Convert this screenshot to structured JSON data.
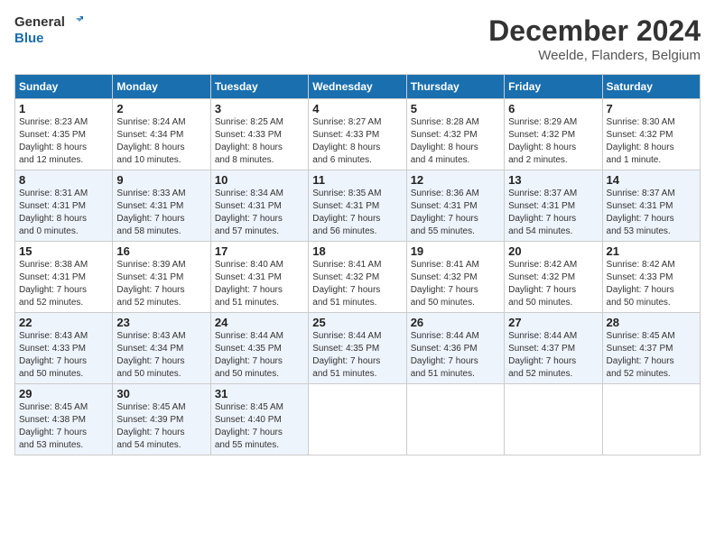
{
  "logo": {
    "general": "General",
    "blue": "Blue"
  },
  "title": {
    "month": "December 2024",
    "location": "Weelde, Flanders, Belgium"
  },
  "headers": [
    "Sunday",
    "Monday",
    "Tuesday",
    "Wednesday",
    "Thursday",
    "Friday",
    "Saturday"
  ],
  "weeks": [
    [
      {
        "day": "1",
        "info": "Sunrise: 8:23 AM\nSunset: 4:35 PM\nDaylight: 8 hours\nand 12 minutes."
      },
      {
        "day": "2",
        "info": "Sunrise: 8:24 AM\nSunset: 4:34 PM\nDaylight: 8 hours\nand 10 minutes."
      },
      {
        "day": "3",
        "info": "Sunrise: 8:25 AM\nSunset: 4:33 PM\nDaylight: 8 hours\nand 8 minutes."
      },
      {
        "day": "4",
        "info": "Sunrise: 8:27 AM\nSunset: 4:33 PM\nDaylight: 8 hours\nand 6 minutes."
      },
      {
        "day": "5",
        "info": "Sunrise: 8:28 AM\nSunset: 4:32 PM\nDaylight: 8 hours\nand 4 minutes."
      },
      {
        "day": "6",
        "info": "Sunrise: 8:29 AM\nSunset: 4:32 PM\nDaylight: 8 hours\nand 2 minutes."
      },
      {
        "day": "7",
        "info": "Sunrise: 8:30 AM\nSunset: 4:32 PM\nDaylight: 8 hours\nand 1 minute."
      }
    ],
    [
      {
        "day": "8",
        "info": "Sunrise: 8:31 AM\nSunset: 4:31 PM\nDaylight: 8 hours\nand 0 minutes."
      },
      {
        "day": "9",
        "info": "Sunrise: 8:33 AM\nSunset: 4:31 PM\nDaylight: 7 hours\nand 58 minutes."
      },
      {
        "day": "10",
        "info": "Sunrise: 8:34 AM\nSunset: 4:31 PM\nDaylight: 7 hours\nand 57 minutes."
      },
      {
        "day": "11",
        "info": "Sunrise: 8:35 AM\nSunset: 4:31 PM\nDaylight: 7 hours\nand 56 minutes."
      },
      {
        "day": "12",
        "info": "Sunrise: 8:36 AM\nSunset: 4:31 PM\nDaylight: 7 hours\nand 55 minutes."
      },
      {
        "day": "13",
        "info": "Sunrise: 8:37 AM\nSunset: 4:31 PM\nDaylight: 7 hours\nand 54 minutes."
      },
      {
        "day": "14",
        "info": "Sunrise: 8:37 AM\nSunset: 4:31 PM\nDaylight: 7 hours\nand 53 minutes."
      }
    ],
    [
      {
        "day": "15",
        "info": "Sunrise: 8:38 AM\nSunset: 4:31 PM\nDaylight: 7 hours\nand 52 minutes."
      },
      {
        "day": "16",
        "info": "Sunrise: 8:39 AM\nSunset: 4:31 PM\nDaylight: 7 hours\nand 52 minutes."
      },
      {
        "day": "17",
        "info": "Sunrise: 8:40 AM\nSunset: 4:31 PM\nDaylight: 7 hours\nand 51 minutes."
      },
      {
        "day": "18",
        "info": "Sunrise: 8:41 AM\nSunset: 4:32 PM\nDaylight: 7 hours\nand 51 minutes."
      },
      {
        "day": "19",
        "info": "Sunrise: 8:41 AM\nSunset: 4:32 PM\nDaylight: 7 hours\nand 50 minutes."
      },
      {
        "day": "20",
        "info": "Sunrise: 8:42 AM\nSunset: 4:32 PM\nDaylight: 7 hours\nand 50 minutes."
      },
      {
        "day": "21",
        "info": "Sunrise: 8:42 AM\nSunset: 4:33 PM\nDaylight: 7 hours\nand 50 minutes."
      }
    ],
    [
      {
        "day": "22",
        "info": "Sunrise: 8:43 AM\nSunset: 4:33 PM\nDaylight: 7 hours\nand 50 minutes."
      },
      {
        "day": "23",
        "info": "Sunrise: 8:43 AM\nSunset: 4:34 PM\nDaylight: 7 hours\nand 50 minutes."
      },
      {
        "day": "24",
        "info": "Sunrise: 8:44 AM\nSunset: 4:35 PM\nDaylight: 7 hours\nand 50 minutes."
      },
      {
        "day": "25",
        "info": "Sunrise: 8:44 AM\nSunset: 4:35 PM\nDaylight: 7 hours\nand 51 minutes."
      },
      {
        "day": "26",
        "info": "Sunrise: 8:44 AM\nSunset: 4:36 PM\nDaylight: 7 hours\nand 51 minutes."
      },
      {
        "day": "27",
        "info": "Sunrise: 8:44 AM\nSunset: 4:37 PM\nDaylight: 7 hours\nand 52 minutes."
      },
      {
        "day": "28",
        "info": "Sunrise: 8:45 AM\nSunset: 4:37 PM\nDaylight: 7 hours\nand 52 minutes."
      }
    ],
    [
      {
        "day": "29",
        "info": "Sunrise: 8:45 AM\nSunset: 4:38 PM\nDaylight: 7 hours\nand 53 minutes."
      },
      {
        "day": "30",
        "info": "Sunrise: 8:45 AM\nSunset: 4:39 PM\nDaylight: 7 hours\nand 54 minutes."
      },
      {
        "day": "31",
        "info": "Sunrise: 8:45 AM\nSunset: 4:40 PM\nDaylight: 7 hours\nand 55 minutes."
      },
      null,
      null,
      null,
      null
    ]
  ]
}
